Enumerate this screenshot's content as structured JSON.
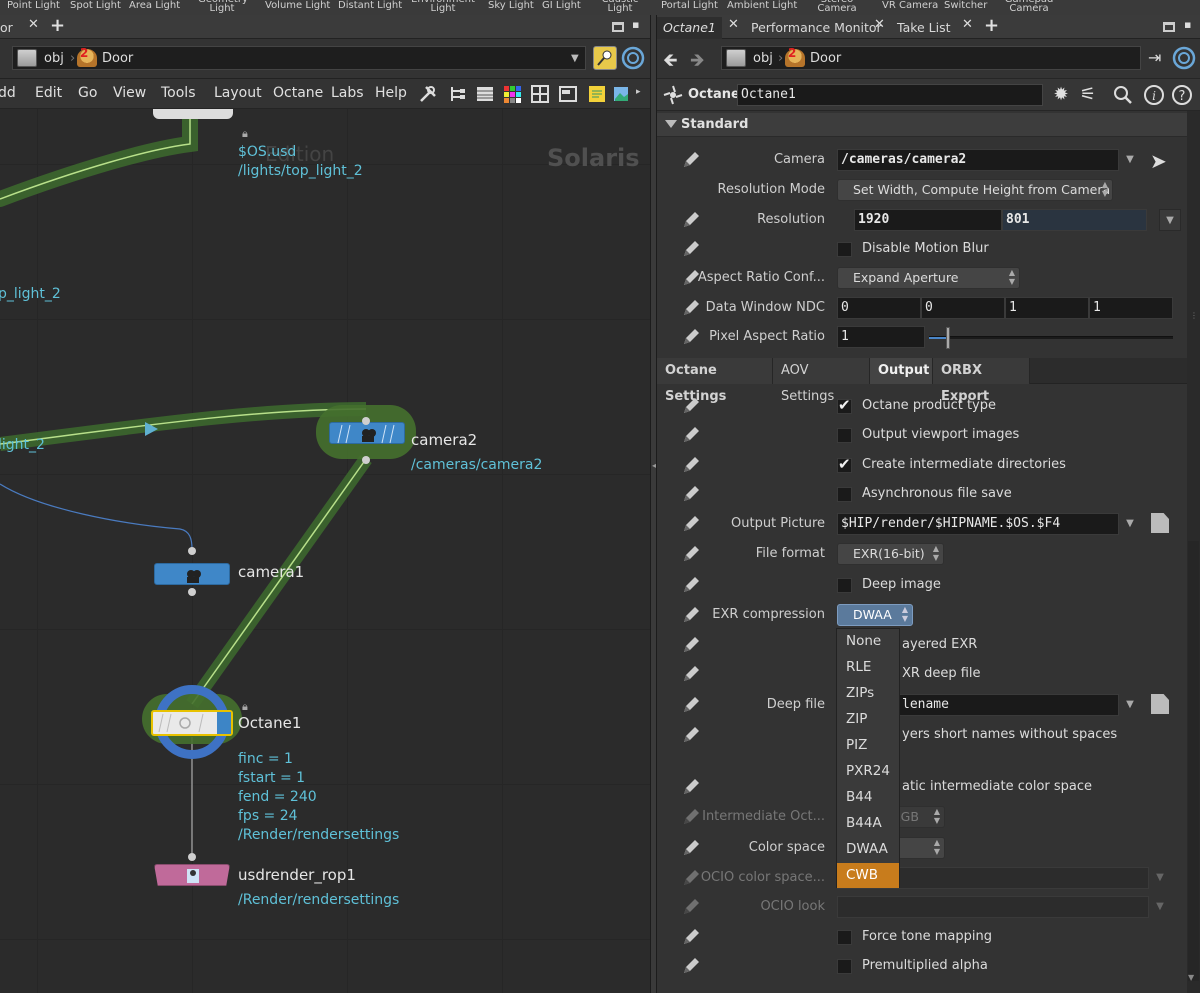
{
  "shelf": {
    "items": [
      "Point Light",
      "Spot Light",
      "Area Light",
      "Geometry Light",
      "Volume Light",
      "Distant Light",
      "Environment Light",
      "Sky Light",
      "GI Light",
      "Caustic Light",
      "Portal Light",
      "Ambient Light",
      "Stereo Camera",
      "VR Camera",
      "Switcher",
      "Gamepad Camera"
    ]
  },
  "left_pane": {
    "tab_label": "or",
    "path": {
      "root": "obj",
      "node": "Door"
    },
    "menu": [
      "dd",
      "Edit",
      "Go",
      "View",
      "Tools",
      "Layout",
      "Octane",
      "Labs",
      "Help"
    ],
    "watermark": "Solaris",
    "watermark_edition": "Edition",
    "nodes": {
      "top_light_path_a": "$OS.usd",
      "top_light_path_b": "/lights/top_light_2",
      "light_label_a": "p_light_2",
      "light_label_b": "light_2",
      "camera2": "camera2",
      "camera2_path": "/cameras/camera2",
      "camera1": "camera1",
      "octane": "Octane1",
      "octane_params": [
        "finc = 1",
        "fstart = 1",
        "fend = 240",
        "fps = 24",
        "/Render/rendersettings"
      ],
      "rop": "usdrender_rop1",
      "rop_path": "/Render/rendersettings"
    }
  },
  "right_pane": {
    "tabs": [
      "Octane1",
      "Performance Monitor",
      "Take List"
    ],
    "path": {
      "root": "obj",
      "node": "Door"
    },
    "node_type": "Octane",
    "node_name": "Octane1",
    "section": "Standard",
    "camera_label": "Camera",
    "camera_value": "/cameras/camera2",
    "res_mode_label": "Resolution Mode",
    "res_mode_value": "Set Width, Compute Height from Camera",
    "resolution_label": "Resolution",
    "resolution_w": "1920",
    "resolution_h": "801",
    "motion_blur_label": "Disable Motion Blur",
    "aspect_label": "Aspect Ratio Conf...",
    "aspect_value": "Expand Aperture",
    "ndc_label": "Data Window NDC",
    "ndc_values": [
      "0",
      "0",
      "1",
      "1"
    ],
    "pixel_aspect_label": "Pixel Aspect Ratio",
    "pixel_aspect_value": "1",
    "pixel_aspect_slider": 0.07,
    "subtabs": [
      "Octane Settings",
      "AOV Settings",
      "Output",
      "ORBX Export"
    ],
    "out": {
      "product_type": "Octane product type",
      "viewport_images": "Output viewport images",
      "intermediate_dirs": "Create intermediate directories",
      "async_save": "Asynchronous file save",
      "output_picture_label": "Output Picture",
      "output_picture_value": "$HIP/render/$HIPNAME.$OS.$F4",
      "file_format_label": "File format",
      "file_format_value": "EXR(16-bit)",
      "deep_image": "Deep image",
      "exr_compression_label": "EXR compression",
      "exr_compression_value": "DWAA",
      "layered_exr": "ayered EXR",
      "exr_deep_file": "XR deep file",
      "deep_file_label": "Deep file",
      "deep_file_value": "lename",
      "short_names": "yers short names without spaces",
      "intermediate_cs": "atic intermediate color space",
      "intermediate_oct_label": "Intermediate Oct...",
      "intermediate_oct_value": "RGB",
      "color_space_label": "Color space",
      "ocio_cs_label": "OCIO color space...",
      "ocio_look_label": "OCIO look",
      "force_tone": "Force tone mapping",
      "premult": "Premultiplied alpha"
    },
    "exr_options": [
      "None",
      "RLE",
      "ZIPs",
      "ZIP",
      "PIZ",
      "PXR24",
      "B44",
      "B44A",
      "DWAA",
      "CWB"
    ],
    "exr_highlight": "CWB"
  }
}
